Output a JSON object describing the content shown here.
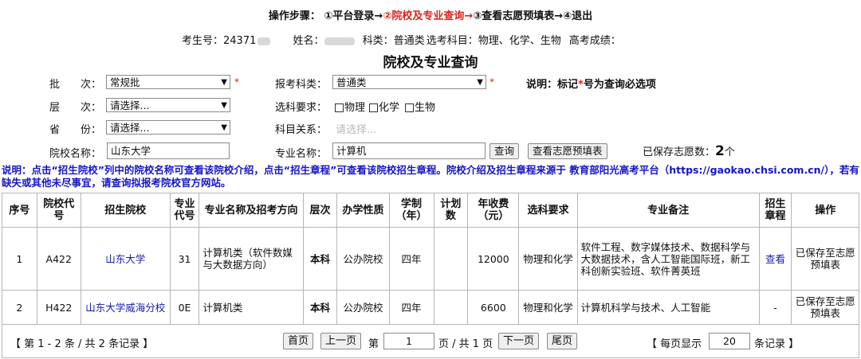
{
  "steps": {
    "label": "操作步骤：",
    "s1": "①平台登录→",
    "s2": "②院校及专业查询→",
    "s3": "③查看志愿预填表→",
    "s4": "④退出"
  },
  "candidate": {
    "exam_no_label": "考生号：",
    "exam_no": "24371",
    "name_label": "姓名：",
    "subject_type_label": "科类：",
    "subject_type": "普通类",
    "elective_label": "选考科目：",
    "electives": "物理、化学、生物",
    "score_label": "高考成绩："
  },
  "page_title": "院校及专业查询",
  "form": {
    "batch_label": "批　　次：",
    "batch_value": "常规批",
    "layer_label": "层　　次：",
    "layer_value": "请选择...",
    "province_label": "省　　份：",
    "province_value": "请选择...",
    "category_label": "报考科类：",
    "category_value": "普通类",
    "required_mark": "*",
    "note_prefix": "说明：标记",
    "note_star": "*",
    "note_suffix": "号为查询必选项",
    "subject_req_label": "选科要求：",
    "subjects": [
      "物理",
      "化学",
      "生物"
    ],
    "relation_label": "科目关系：",
    "relation_placeholder": "请选择...",
    "school_name_label": "院校名称：",
    "school_name_value": "山东大学",
    "major_name_label": "专业名称：",
    "major_name_value": "计算机",
    "query_button": "查询",
    "view_button": "查看志愿预填表",
    "saved_label": "已保存志愿数：",
    "saved_count": "2",
    "saved_unit": "个"
  },
  "description": "说明：点击“招生院校”列中的院校名称可查看该院校介绍，点击“招生章程”可查看该院校招生章程。院校介绍及招生章程来源于 教育部阳光高考平台（https://gaokao.chsi.com.cn/），若有缺失或其他未尽事宜，请查询拟报考院校官方网站。",
  "table": {
    "headers": [
      "序号",
      "院校代号",
      "招生院校",
      "专业代号",
      "专业名称及招考方向",
      "层次",
      "办学性质",
      "学制（年）",
      "计划数",
      "年收费（元）",
      "选科要求",
      "专业备注",
      "招生章程",
      "操作"
    ],
    "rows": [
      {
        "no": "1",
        "code": "A422",
        "school": "山东大学",
        "major_code": "31",
        "major_name": "计算机类（软件数媒与大数据方向）",
        "level": "本科",
        "nature": "公办院校",
        "years": "四年",
        "plan": "",
        "fee": "12000",
        "subject_req": "物理和化学",
        "remark": "软件工程、数字媒体技术、数据科学与大数据技术，含人工智能国际班，新工科创新实验班、软件菁英班",
        "charter": "查看",
        "action": "已保存至志愿预填表"
      },
      {
        "no": "2",
        "code": "H422",
        "school": "山东大学威海分校",
        "major_code": "0E",
        "major_name": "计算机类",
        "level": "本科",
        "nature": "公办院校",
        "years": "四年",
        "plan": "",
        "fee": "6600",
        "subject_req": "物理和化学",
        "remark": "计算机科学与技术、人工智能",
        "charter": "-",
        "action": "已保存至志愿预填表"
      }
    ]
  },
  "pager": {
    "total": "【 第 1 - 2 条 / 共 2 条记录 】",
    "first": "首页",
    "prev": "上一页",
    "page_prefix": "第",
    "page_value": "1",
    "page_suffix": "页 / 共 1 页",
    "next": "下一页",
    "last": "尾页",
    "per_page_prefix": "【 每页显示",
    "per_page_value": "20",
    "per_page_suffix": "条记录 】"
  }
}
